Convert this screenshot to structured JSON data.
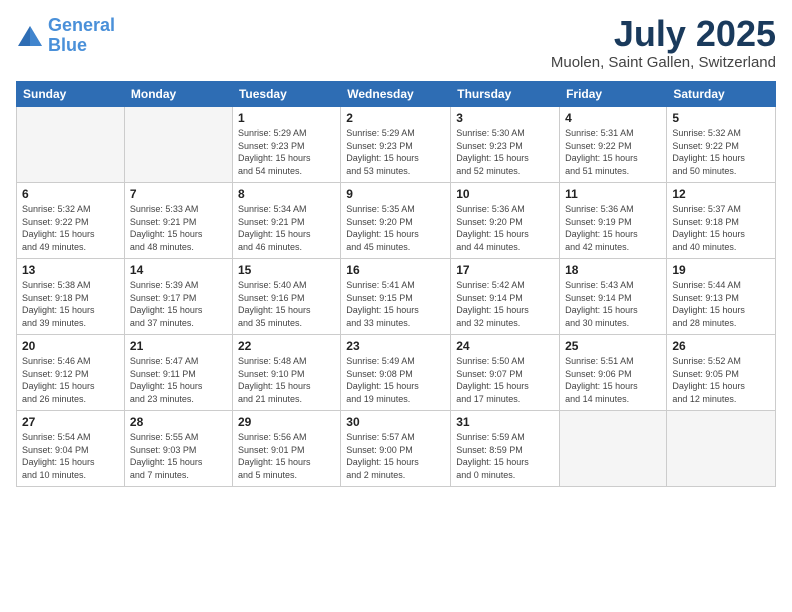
{
  "header": {
    "logo_line1": "General",
    "logo_line2": "Blue",
    "title": "July 2025",
    "location": "Muolen, Saint Gallen, Switzerland"
  },
  "weekdays": [
    "Sunday",
    "Monday",
    "Tuesday",
    "Wednesday",
    "Thursday",
    "Friday",
    "Saturday"
  ],
  "weeks": [
    [
      {
        "day": "",
        "info": ""
      },
      {
        "day": "",
        "info": ""
      },
      {
        "day": "1",
        "info": "Sunrise: 5:29 AM\nSunset: 9:23 PM\nDaylight: 15 hours\nand 54 minutes."
      },
      {
        "day": "2",
        "info": "Sunrise: 5:29 AM\nSunset: 9:23 PM\nDaylight: 15 hours\nand 53 minutes."
      },
      {
        "day": "3",
        "info": "Sunrise: 5:30 AM\nSunset: 9:23 PM\nDaylight: 15 hours\nand 52 minutes."
      },
      {
        "day": "4",
        "info": "Sunrise: 5:31 AM\nSunset: 9:22 PM\nDaylight: 15 hours\nand 51 minutes."
      },
      {
        "day": "5",
        "info": "Sunrise: 5:32 AM\nSunset: 9:22 PM\nDaylight: 15 hours\nand 50 minutes."
      }
    ],
    [
      {
        "day": "6",
        "info": "Sunrise: 5:32 AM\nSunset: 9:22 PM\nDaylight: 15 hours\nand 49 minutes."
      },
      {
        "day": "7",
        "info": "Sunrise: 5:33 AM\nSunset: 9:21 PM\nDaylight: 15 hours\nand 48 minutes."
      },
      {
        "day": "8",
        "info": "Sunrise: 5:34 AM\nSunset: 9:21 PM\nDaylight: 15 hours\nand 46 minutes."
      },
      {
        "day": "9",
        "info": "Sunrise: 5:35 AM\nSunset: 9:20 PM\nDaylight: 15 hours\nand 45 minutes."
      },
      {
        "day": "10",
        "info": "Sunrise: 5:36 AM\nSunset: 9:20 PM\nDaylight: 15 hours\nand 44 minutes."
      },
      {
        "day": "11",
        "info": "Sunrise: 5:36 AM\nSunset: 9:19 PM\nDaylight: 15 hours\nand 42 minutes."
      },
      {
        "day": "12",
        "info": "Sunrise: 5:37 AM\nSunset: 9:18 PM\nDaylight: 15 hours\nand 40 minutes."
      }
    ],
    [
      {
        "day": "13",
        "info": "Sunrise: 5:38 AM\nSunset: 9:18 PM\nDaylight: 15 hours\nand 39 minutes."
      },
      {
        "day": "14",
        "info": "Sunrise: 5:39 AM\nSunset: 9:17 PM\nDaylight: 15 hours\nand 37 minutes."
      },
      {
        "day": "15",
        "info": "Sunrise: 5:40 AM\nSunset: 9:16 PM\nDaylight: 15 hours\nand 35 minutes."
      },
      {
        "day": "16",
        "info": "Sunrise: 5:41 AM\nSunset: 9:15 PM\nDaylight: 15 hours\nand 33 minutes."
      },
      {
        "day": "17",
        "info": "Sunrise: 5:42 AM\nSunset: 9:14 PM\nDaylight: 15 hours\nand 32 minutes."
      },
      {
        "day": "18",
        "info": "Sunrise: 5:43 AM\nSunset: 9:14 PM\nDaylight: 15 hours\nand 30 minutes."
      },
      {
        "day": "19",
        "info": "Sunrise: 5:44 AM\nSunset: 9:13 PM\nDaylight: 15 hours\nand 28 minutes."
      }
    ],
    [
      {
        "day": "20",
        "info": "Sunrise: 5:46 AM\nSunset: 9:12 PM\nDaylight: 15 hours\nand 26 minutes."
      },
      {
        "day": "21",
        "info": "Sunrise: 5:47 AM\nSunset: 9:11 PM\nDaylight: 15 hours\nand 23 minutes."
      },
      {
        "day": "22",
        "info": "Sunrise: 5:48 AM\nSunset: 9:10 PM\nDaylight: 15 hours\nand 21 minutes."
      },
      {
        "day": "23",
        "info": "Sunrise: 5:49 AM\nSunset: 9:08 PM\nDaylight: 15 hours\nand 19 minutes."
      },
      {
        "day": "24",
        "info": "Sunrise: 5:50 AM\nSunset: 9:07 PM\nDaylight: 15 hours\nand 17 minutes."
      },
      {
        "day": "25",
        "info": "Sunrise: 5:51 AM\nSunset: 9:06 PM\nDaylight: 15 hours\nand 14 minutes."
      },
      {
        "day": "26",
        "info": "Sunrise: 5:52 AM\nSunset: 9:05 PM\nDaylight: 15 hours\nand 12 minutes."
      }
    ],
    [
      {
        "day": "27",
        "info": "Sunrise: 5:54 AM\nSunset: 9:04 PM\nDaylight: 15 hours\nand 10 minutes."
      },
      {
        "day": "28",
        "info": "Sunrise: 5:55 AM\nSunset: 9:03 PM\nDaylight: 15 hours\nand 7 minutes."
      },
      {
        "day": "29",
        "info": "Sunrise: 5:56 AM\nSunset: 9:01 PM\nDaylight: 15 hours\nand 5 minutes."
      },
      {
        "day": "30",
        "info": "Sunrise: 5:57 AM\nSunset: 9:00 PM\nDaylight: 15 hours\nand 2 minutes."
      },
      {
        "day": "31",
        "info": "Sunrise: 5:59 AM\nSunset: 8:59 PM\nDaylight: 15 hours\nand 0 minutes."
      },
      {
        "day": "",
        "info": ""
      },
      {
        "day": "",
        "info": ""
      }
    ]
  ]
}
